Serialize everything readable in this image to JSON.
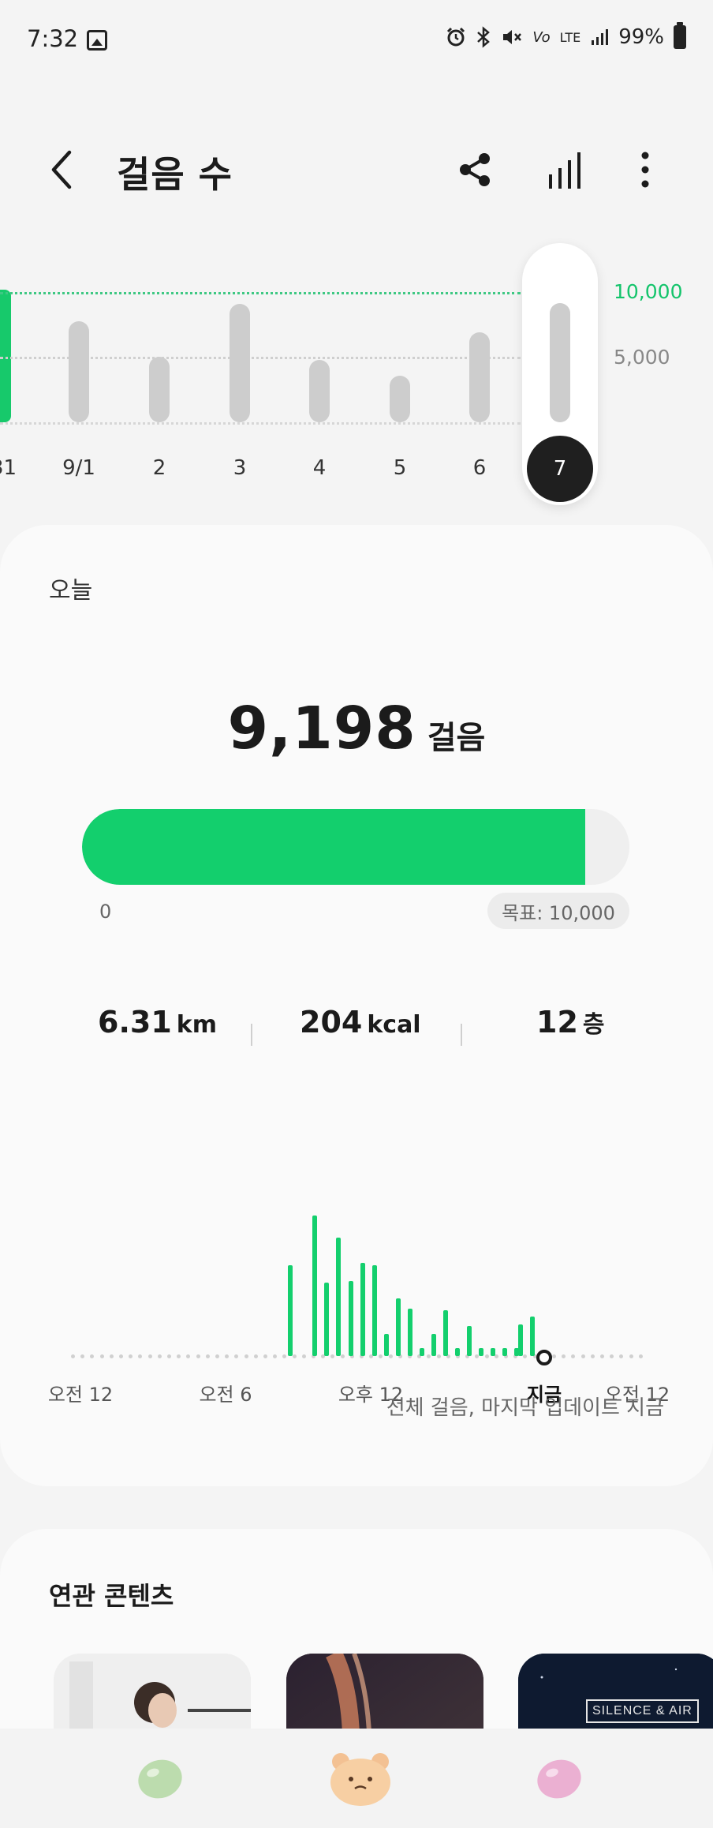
{
  "status_bar": {
    "time": "7:32",
    "battery": "99%",
    "network": "LTE"
  },
  "header": {
    "title": "걸음 수",
    "back_icon": "chevron-left-icon",
    "share_icon": "share-icon",
    "chart_icon": "bar-chart-icon",
    "more_icon": "more-vertical-icon"
  },
  "week_chart": {
    "goal_label": "10,000",
    "mid_label": "5,000",
    "days": [
      {
        "label": "31"
      },
      {
        "label": "9/1"
      },
      {
        "label": "2"
      },
      {
        "label": "3"
      },
      {
        "label": "4"
      },
      {
        "label": "5"
      },
      {
        "label": "6"
      },
      {
        "label": "7"
      }
    ]
  },
  "today": {
    "label": "오늘",
    "steps": "9,198",
    "steps_unit": "걸음",
    "progress_fraction": 0.9198,
    "progress_min": "0",
    "goal_text": "목표: 10,000",
    "distance": "6.31",
    "distance_unit": "km",
    "calories": "204",
    "calories_unit": "kcal",
    "floors": "12",
    "floors_unit": "층",
    "hour_labels": [
      "오전 12",
      "오전 6",
      "오후 12",
      "지금",
      "오전 12"
    ],
    "update_note": "전체 걸음, 마지막 업데이트 지금"
  },
  "related": {
    "title": "연관 콘텐츠",
    "thumb3_text": "SILENCE & AIR"
  },
  "colors": {
    "accent": "#13cf6d",
    "goal_line": "#3ec883",
    "inactive_bar": "#cdcdcd"
  }
}
